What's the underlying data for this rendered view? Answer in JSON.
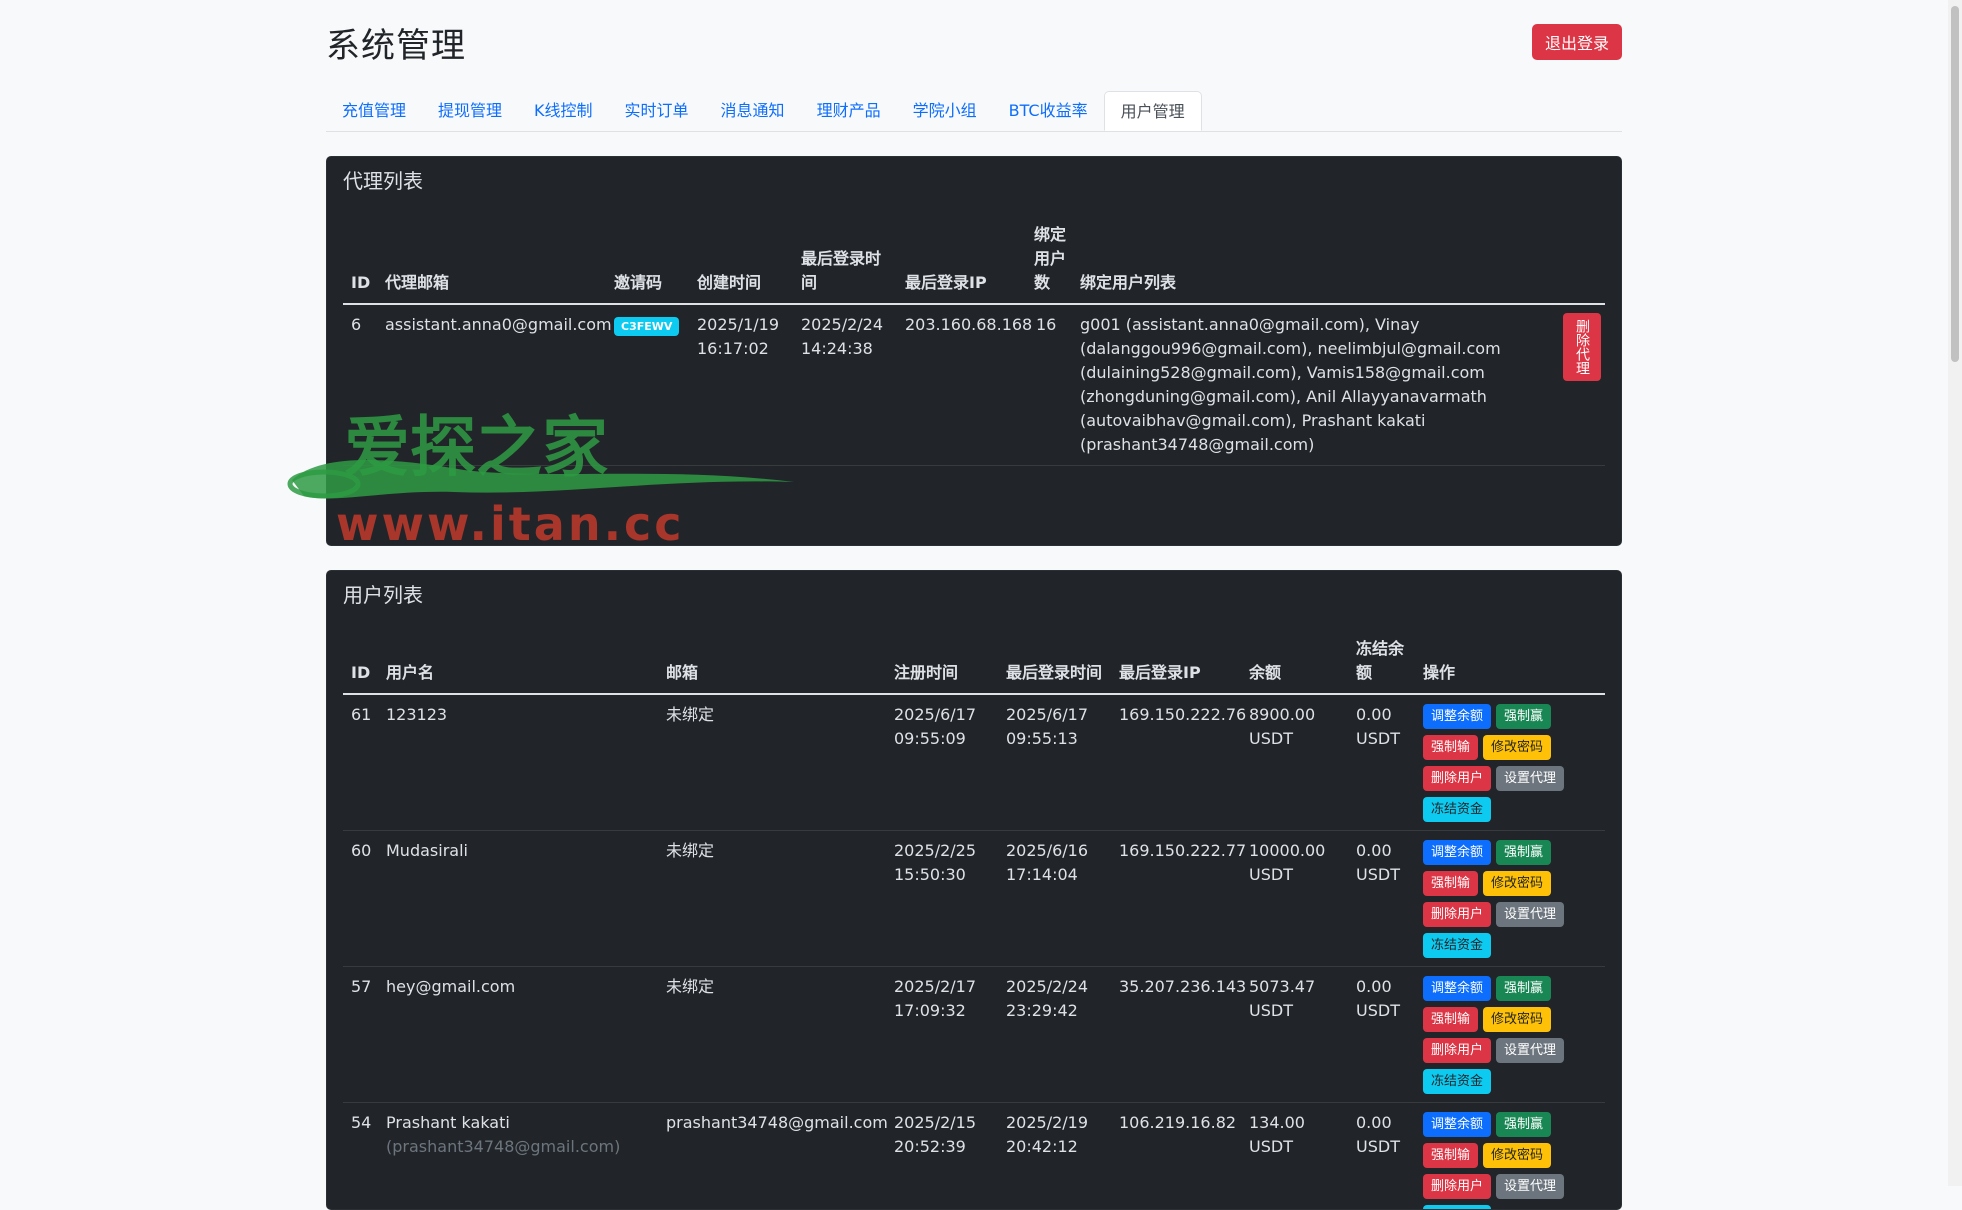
{
  "header": {
    "title": "系统管理",
    "logout_label": "退出登录"
  },
  "tabs": [
    {
      "label": "充值管理"
    },
    {
      "label": "提现管理"
    },
    {
      "label": "K线控制"
    },
    {
      "label": "实时订单"
    },
    {
      "label": "消息通知"
    },
    {
      "label": "理财产品"
    },
    {
      "label": "学院小组"
    },
    {
      "label": "BTC收益率"
    },
    {
      "label": "用户管理",
      "active": true
    }
  ],
  "agents": {
    "title": "代理列表",
    "columns": [
      "ID",
      "代理邮箱",
      "邀请码",
      "创建时间",
      "最后登录时间",
      "最后登录IP",
      "绑定用户数",
      "绑定用户列表"
    ],
    "rows": [
      {
        "id": "6",
        "email": "assistant.anna0@gmail.com",
        "code": "C3FEWV",
        "created_date": "2025/1/19",
        "created_time": "16:17:02",
        "last_login_date": "2025/2/24",
        "last_login_time": "14:24:38",
        "ip": "203.160.68.168",
        "count": "16",
        "bound_list": "g001 (assistant.anna0@gmail.com), Vinay (dalanggou996@gmail.com), neelimbjul@gmail.com (dulaining528@gmail.com), Vamis158@gmail.com (zhongduning@gmail.com), Anil Allayyanavarmath (autovaibhav@gmail.com), Prashant kakati (prashant34748@gmail.com)",
        "delete_label": "删除代理"
      }
    ]
  },
  "users": {
    "title": "用户列表",
    "columns": [
      "ID",
      "用户名",
      "邮箱",
      "注册时间",
      "最后登录时间",
      "最后登录IP",
      "余额",
      "冻结余额",
      "操作"
    ],
    "actions": {
      "adjust": "调整余额",
      "force_win": "强制赢",
      "force_lose": "强制输",
      "change_pwd": "修改密码",
      "delete": "删除用户",
      "set_agent": "设置代理",
      "freeze": "冻结资金"
    },
    "rows": [
      {
        "id": "61",
        "username": "123123",
        "username_sub": "",
        "email": "未绑定",
        "reg_date": "2025/6/17",
        "reg_time": "09:55:09",
        "login_date": "2025/6/17",
        "login_time": "09:55:13",
        "ip": "169.150.222.76",
        "balance": "8900.00",
        "frozen": "0.00",
        "unit": "USDT"
      },
      {
        "id": "60",
        "username": "Mudasirali",
        "username_sub": "",
        "email": "未绑定",
        "reg_date": "2025/2/25",
        "reg_time": "15:50:30",
        "login_date": "2025/6/16",
        "login_time": "17:14:04",
        "ip": "169.150.222.77",
        "balance": "10000.00",
        "frozen": "0.00",
        "unit": "USDT"
      },
      {
        "id": "57",
        "username": "hey@gmail.com",
        "username_sub": "",
        "email": "未绑定",
        "reg_date": "2025/2/17",
        "reg_time": "17:09:32",
        "login_date": "2025/2/24",
        "login_time": "23:29:42",
        "ip": "35.207.236.143",
        "balance": "5073.47",
        "frozen": "0.00",
        "unit": "USDT"
      },
      {
        "id": "54",
        "username": "Prashant kakati",
        "username_sub": "(prashant34748@gmail.com)",
        "email": "prashant34748@gmail.com",
        "reg_date": "2025/2/15",
        "reg_time": "20:52:39",
        "login_date": "2025/2/19",
        "login_time": "20:42:12",
        "ip": "106.219.16.82",
        "balance": "134.00",
        "frozen": "0.00",
        "unit": "USDT"
      }
    ]
  },
  "watermark": {
    "cn": "爱探之家",
    "url": "www.itan.cc"
  }
}
